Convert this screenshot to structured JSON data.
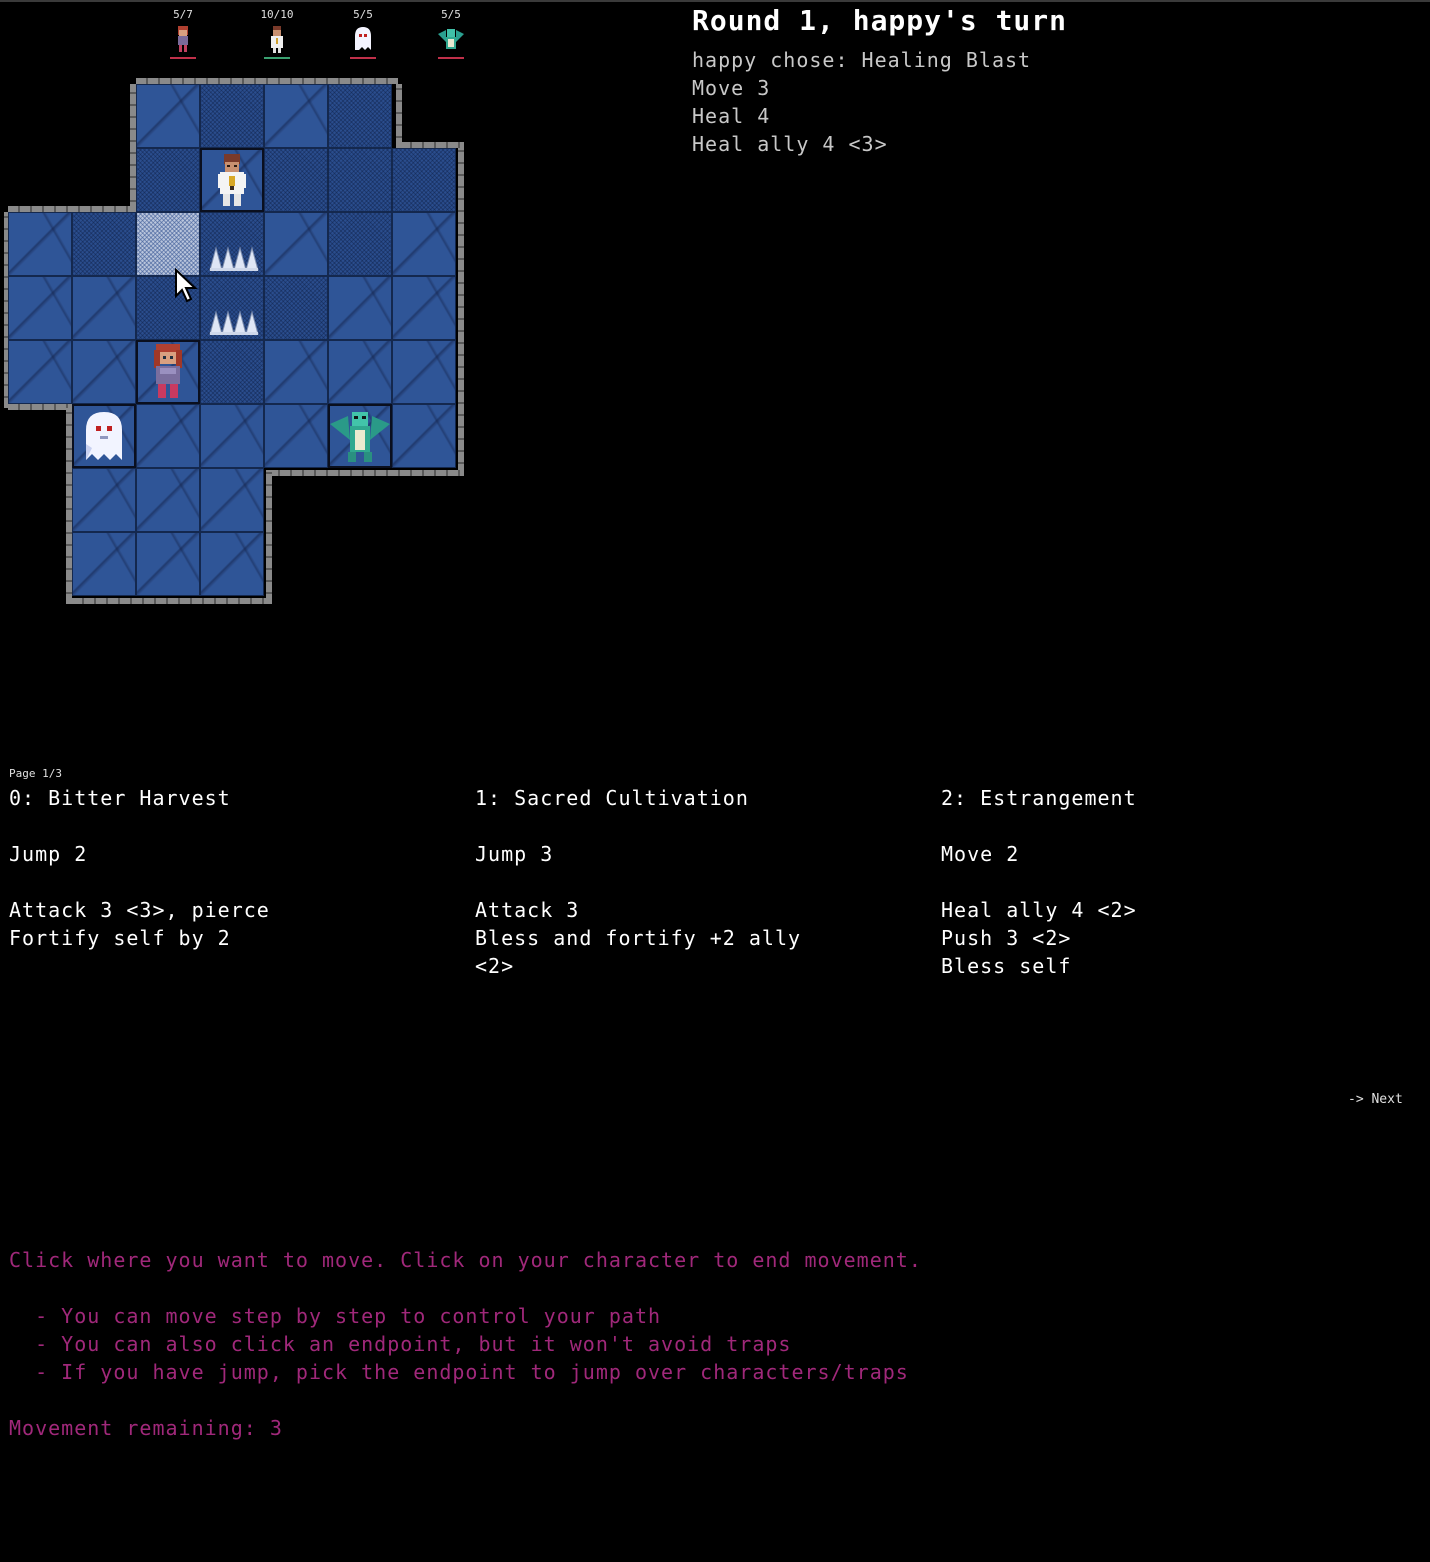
{
  "party": [
    {
      "hp": "5/7",
      "line_color": "#c0304a",
      "portrait": "red-haired-heroine-icon"
    },
    {
      "hp": "10/10",
      "line_color": "#3aa070",
      "portrait": "white-robed-priest-icon"
    },
    {
      "hp": "5/5",
      "line_color": "#c0304a",
      "portrait": "white-ghost-icon"
    },
    {
      "hp": "5/5",
      "line_color": "#c0304a",
      "portrait": "teal-dragon-icon"
    }
  ],
  "turn": {
    "title": "Round 1, happy's turn",
    "chose": "happy chose: Healing Blast",
    "lines": [
      "Move 3",
      "Heal 4",
      "Heal ally 4 <3>"
    ]
  },
  "cards": {
    "page_label": "Page 1/3",
    "items": [
      {
        "title": "0: Bitter Harvest",
        "move": "Jump 2",
        "actions": [
          "Attack 3 <3>, pierce",
          "Fortify self by 2"
        ]
      },
      {
        "title": "1: Sacred Cultivation",
        "move": "Jump 3",
        "actions": [
          "Attack 3",
          "Bless and fortify +2 ally",
          "<2>"
        ]
      },
      {
        "title": "2: Estrangement",
        "move": "Move 2",
        "actions": [
          "Heal ally 4 <2>",
          "Push 3 <2>",
          "Bless self"
        ]
      }
    ],
    "next_label": "-> Next"
  },
  "instructions": {
    "main": "Click where you want to move. Click on your character to end movement.",
    "tips": [
      "  - You can move step by step to control your path",
      "  - You can also click an endpoint, but it won't avoid traps",
      "  - If you have jump, pick the endpoint to jump over characters/traps"
    ],
    "movement_remaining": "Movement remaining: 3"
  },
  "colors": {
    "tile": "#2f5597",
    "selected_tile": "#b9c5dc",
    "instruction_text": "#a0287a"
  }
}
